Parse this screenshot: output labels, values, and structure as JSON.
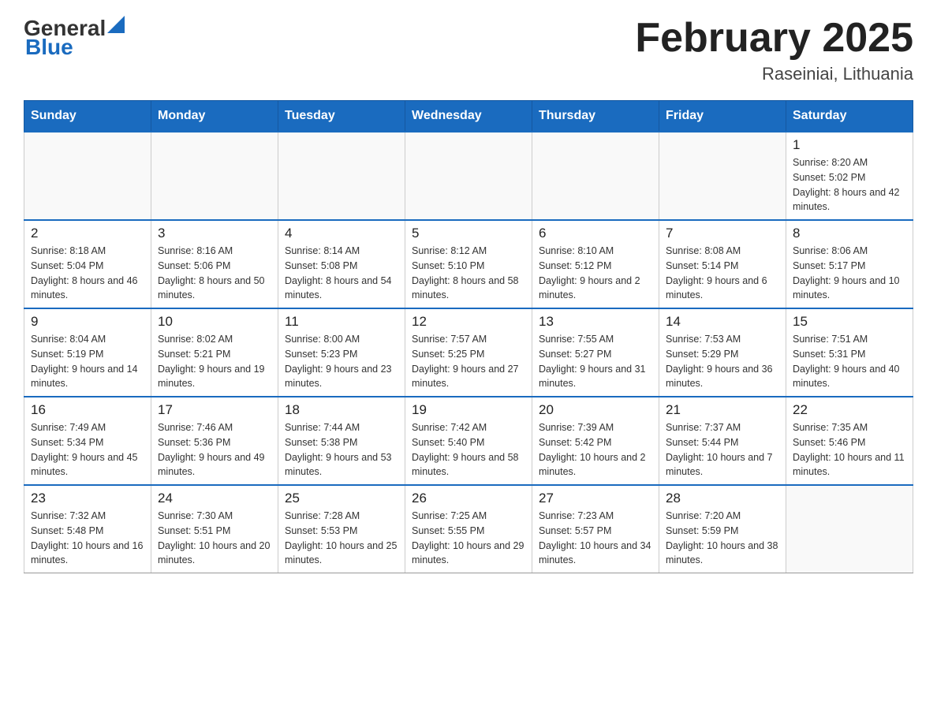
{
  "header": {
    "logo_general": "General",
    "logo_blue": "Blue",
    "title": "February 2025",
    "subtitle": "Raseiniai, Lithuania"
  },
  "days_of_week": [
    "Sunday",
    "Monday",
    "Tuesday",
    "Wednesday",
    "Thursday",
    "Friday",
    "Saturday"
  ],
  "weeks": [
    [
      {
        "day": "",
        "sunrise": "",
        "sunset": "",
        "daylight": ""
      },
      {
        "day": "",
        "sunrise": "",
        "sunset": "",
        "daylight": ""
      },
      {
        "day": "",
        "sunrise": "",
        "sunset": "",
        "daylight": ""
      },
      {
        "day": "",
        "sunrise": "",
        "sunset": "",
        "daylight": ""
      },
      {
        "day": "",
        "sunrise": "",
        "sunset": "",
        "daylight": ""
      },
      {
        "day": "",
        "sunrise": "",
        "sunset": "",
        "daylight": ""
      },
      {
        "day": "1",
        "sunrise": "Sunrise: 8:20 AM",
        "sunset": "Sunset: 5:02 PM",
        "daylight": "Daylight: 8 hours and 42 minutes."
      }
    ],
    [
      {
        "day": "2",
        "sunrise": "Sunrise: 8:18 AM",
        "sunset": "Sunset: 5:04 PM",
        "daylight": "Daylight: 8 hours and 46 minutes."
      },
      {
        "day": "3",
        "sunrise": "Sunrise: 8:16 AM",
        "sunset": "Sunset: 5:06 PM",
        "daylight": "Daylight: 8 hours and 50 minutes."
      },
      {
        "day": "4",
        "sunrise": "Sunrise: 8:14 AM",
        "sunset": "Sunset: 5:08 PM",
        "daylight": "Daylight: 8 hours and 54 minutes."
      },
      {
        "day": "5",
        "sunrise": "Sunrise: 8:12 AM",
        "sunset": "Sunset: 5:10 PM",
        "daylight": "Daylight: 8 hours and 58 minutes."
      },
      {
        "day": "6",
        "sunrise": "Sunrise: 8:10 AM",
        "sunset": "Sunset: 5:12 PM",
        "daylight": "Daylight: 9 hours and 2 minutes."
      },
      {
        "day": "7",
        "sunrise": "Sunrise: 8:08 AM",
        "sunset": "Sunset: 5:14 PM",
        "daylight": "Daylight: 9 hours and 6 minutes."
      },
      {
        "day": "8",
        "sunrise": "Sunrise: 8:06 AM",
        "sunset": "Sunset: 5:17 PM",
        "daylight": "Daylight: 9 hours and 10 minutes."
      }
    ],
    [
      {
        "day": "9",
        "sunrise": "Sunrise: 8:04 AM",
        "sunset": "Sunset: 5:19 PM",
        "daylight": "Daylight: 9 hours and 14 minutes."
      },
      {
        "day": "10",
        "sunrise": "Sunrise: 8:02 AM",
        "sunset": "Sunset: 5:21 PM",
        "daylight": "Daylight: 9 hours and 19 minutes."
      },
      {
        "day": "11",
        "sunrise": "Sunrise: 8:00 AM",
        "sunset": "Sunset: 5:23 PM",
        "daylight": "Daylight: 9 hours and 23 minutes."
      },
      {
        "day": "12",
        "sunrise": "Sunrise: 7:57 AM",
        "sunset": "Sunset: 5:25 PM",
        "daylight": "Daylight: 9 hours and 27 minutes."
      },
      {
        "day": "13",
        "sunrise": "Sunrise: 7:55 AM",
        "sunset": "Sunset: 5:27 PM",
        "daylight": "Daylight: 9 hours and 31 minutes."
      },
      {
        "day": "14",
        "sunrise": "Sunrise: 7:53 AM",
        "sunset": "Sunset: 5:29 PM",
        "daylight": "Daylight: 9 hours and 36 minutes."
      },
      {
        "day": "15",
        "sunrise": "Sunrise: 7:51 AM",
        "sunset": "Sunset: 5:31 PM",
        "daylight": "Daylight: 9 hours and 40 minutes."
      }
    ],
    [
      {
        "day": "16",
        "sunrise": "Sunrise: 7:49 AM",
        "sunset": "Sunset: 5:34 PM",
        "daylight": "Daylight: 9 hours and 45 minutes."
      },
      {
        "day": "17",
        "sunrise": "Sunrise: 7:46 AM",
        "sunset": "Sunset: 5:36 PM",
        "daylight": "Daylight: 9 hours and 49 minutes."
      },
      {
        "day": "18",
        "sunrise": "Sunrise: 7:44 AM",
        "sunset": "Sunset: 5:38 PM",
        "daylight": "Daylight: 9 hours and 53 minutes."
      },
      {
        "day": "19",
        "sunrise": "Sunrise: 7:42 AM",
        "sunset": "Sunset: 5:40 PM",
        "daylight": "Daylight: 9 hours and 58 minutes."
      },
      {
        "day": "20",
        "sunrise": "Sunrise: 7:39 AM",
        "sunset": "Sunset: 5:42 PM",
        "daylight": "Daylight: 10 hours and 2 minutes."
      },
      {
        "day": "21",
        "sunrise": "Sunrise: 7:37 AM",
        "sunset": "Sunset: 5:44 PM",
        "daylight": "Daylight: 10 hours and 7 minutes."
      },
      {
        "day": "22",
        "sunrise": "Sunrise: 7:35 AM",
        "sunset": "Sunset: 5:46 PM",
        "daylight": "Daylight: 10 hours and 11 minutes."
      }
    ],
    [
      {
        "day": "23",
        "sunrise": "Sunrise: 7:32 AM",
        "sunset": "Sunset: 5:48 PM",
        "daylight": "Daylight: 10 hours and 16 minutes."
      },
      {
        "day": "24",
        "sunrise": "Sunrise: 7:30 AM",
        "sunset": "Sunset: 5:51 PM",
        "daylight": "Daylight: 10 hours and 20 minutes."
      },
      {
        "day": "25",
        "sunrise": "Sunrise: 7:28 AM",
        "sunset": "Sunset: 5:53 PM",
        "daylight": "Daylight: 10 hours and 25 minutes."
      },
      {
        "day": "26",
        "sunrise": "Sunrise: 7:25 AM",
        "sunset": "Sunset: 5:55 PM",
        "daylight": "Daylight: 10 hours and 29 minutes."
      },
      {
        "day": "27",
        "sunrise": "Sunrise: 7:23 AM",
        "sunset": "Sunset: 5:57 PM",
        "daylight": "Daylight: 10 hours and 34 minutes."
      },
      {
        "day": "28",
        "sunrise": "Sunrise: 7:20 AM",
        "sunset": "Sunset: 5:59 PM",
        "daylight": "Daylight: 10 hours and 38 minutes."
      },
      {
        "day": "",
        "sunrise": "",
        "sunset": "",
        "daylight": ""
      }
    ]
  ]
}
